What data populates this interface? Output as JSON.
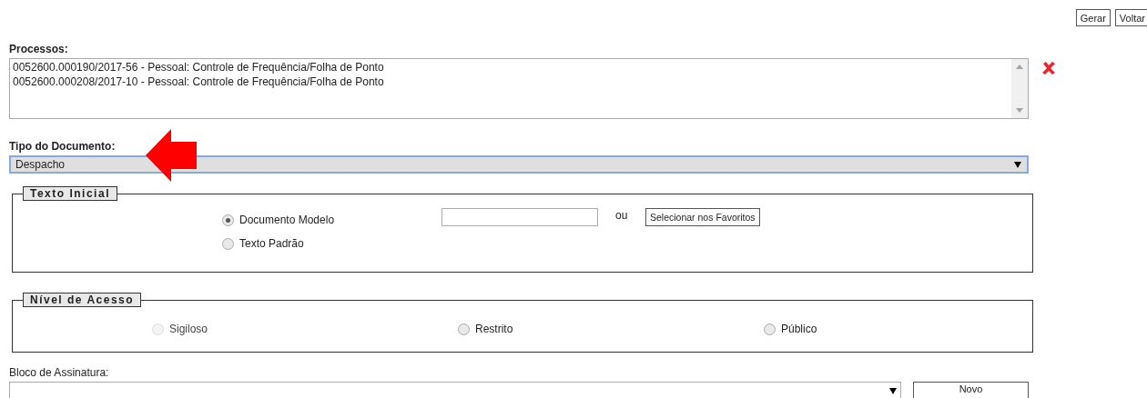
{
  "toolbar": {
    "buttons": [
      "Gerar",
      "Voltar"
    ]
  },
  "processos": {
    "label": "Processos:",
    "items": [
      "0052600.000190/2017-56 - Pessoal: Controle de Frequência/Folha de Ponto",
      "0052600.000208/2017-10 - Pessoal: Controle de Frequência/Folha de Ponto"
    ]
  },
  "tipo_documento": {
    "label": "Tipo do Documento:",
    "value": "Despacho",
    "focused": true
  },
  "texto_inicial": {
    "legend": "Texto Inicial",
    "options": [
      {
        "label": "Documento Modelo",
        "selected": true,
        "disabled": false
      },
      {
        "label": "Texto Padrão",
        "selected": false,
        "disabled": false
      }
    ],
    "separator": "ou",
    "button": "Selecionar nos Favoritos"
  },
  "nivel_acesso": {
    "legend": "Nível de Acesso",
    "options": [
      {
        "label": "Sigiloso",
        "selected": false,
        "disabled": true
      },
      {
        "label": "Restrito",
        "selected": false,
        "disabled": false
      },
      {
        "label": "Público",
        "selected": false,
        "disabled": false
      }
    ]
  },
  "bloco_assinatura": {
    "label": "Bloco de Assinatura:",
    "button": "Novo"
  }
}
